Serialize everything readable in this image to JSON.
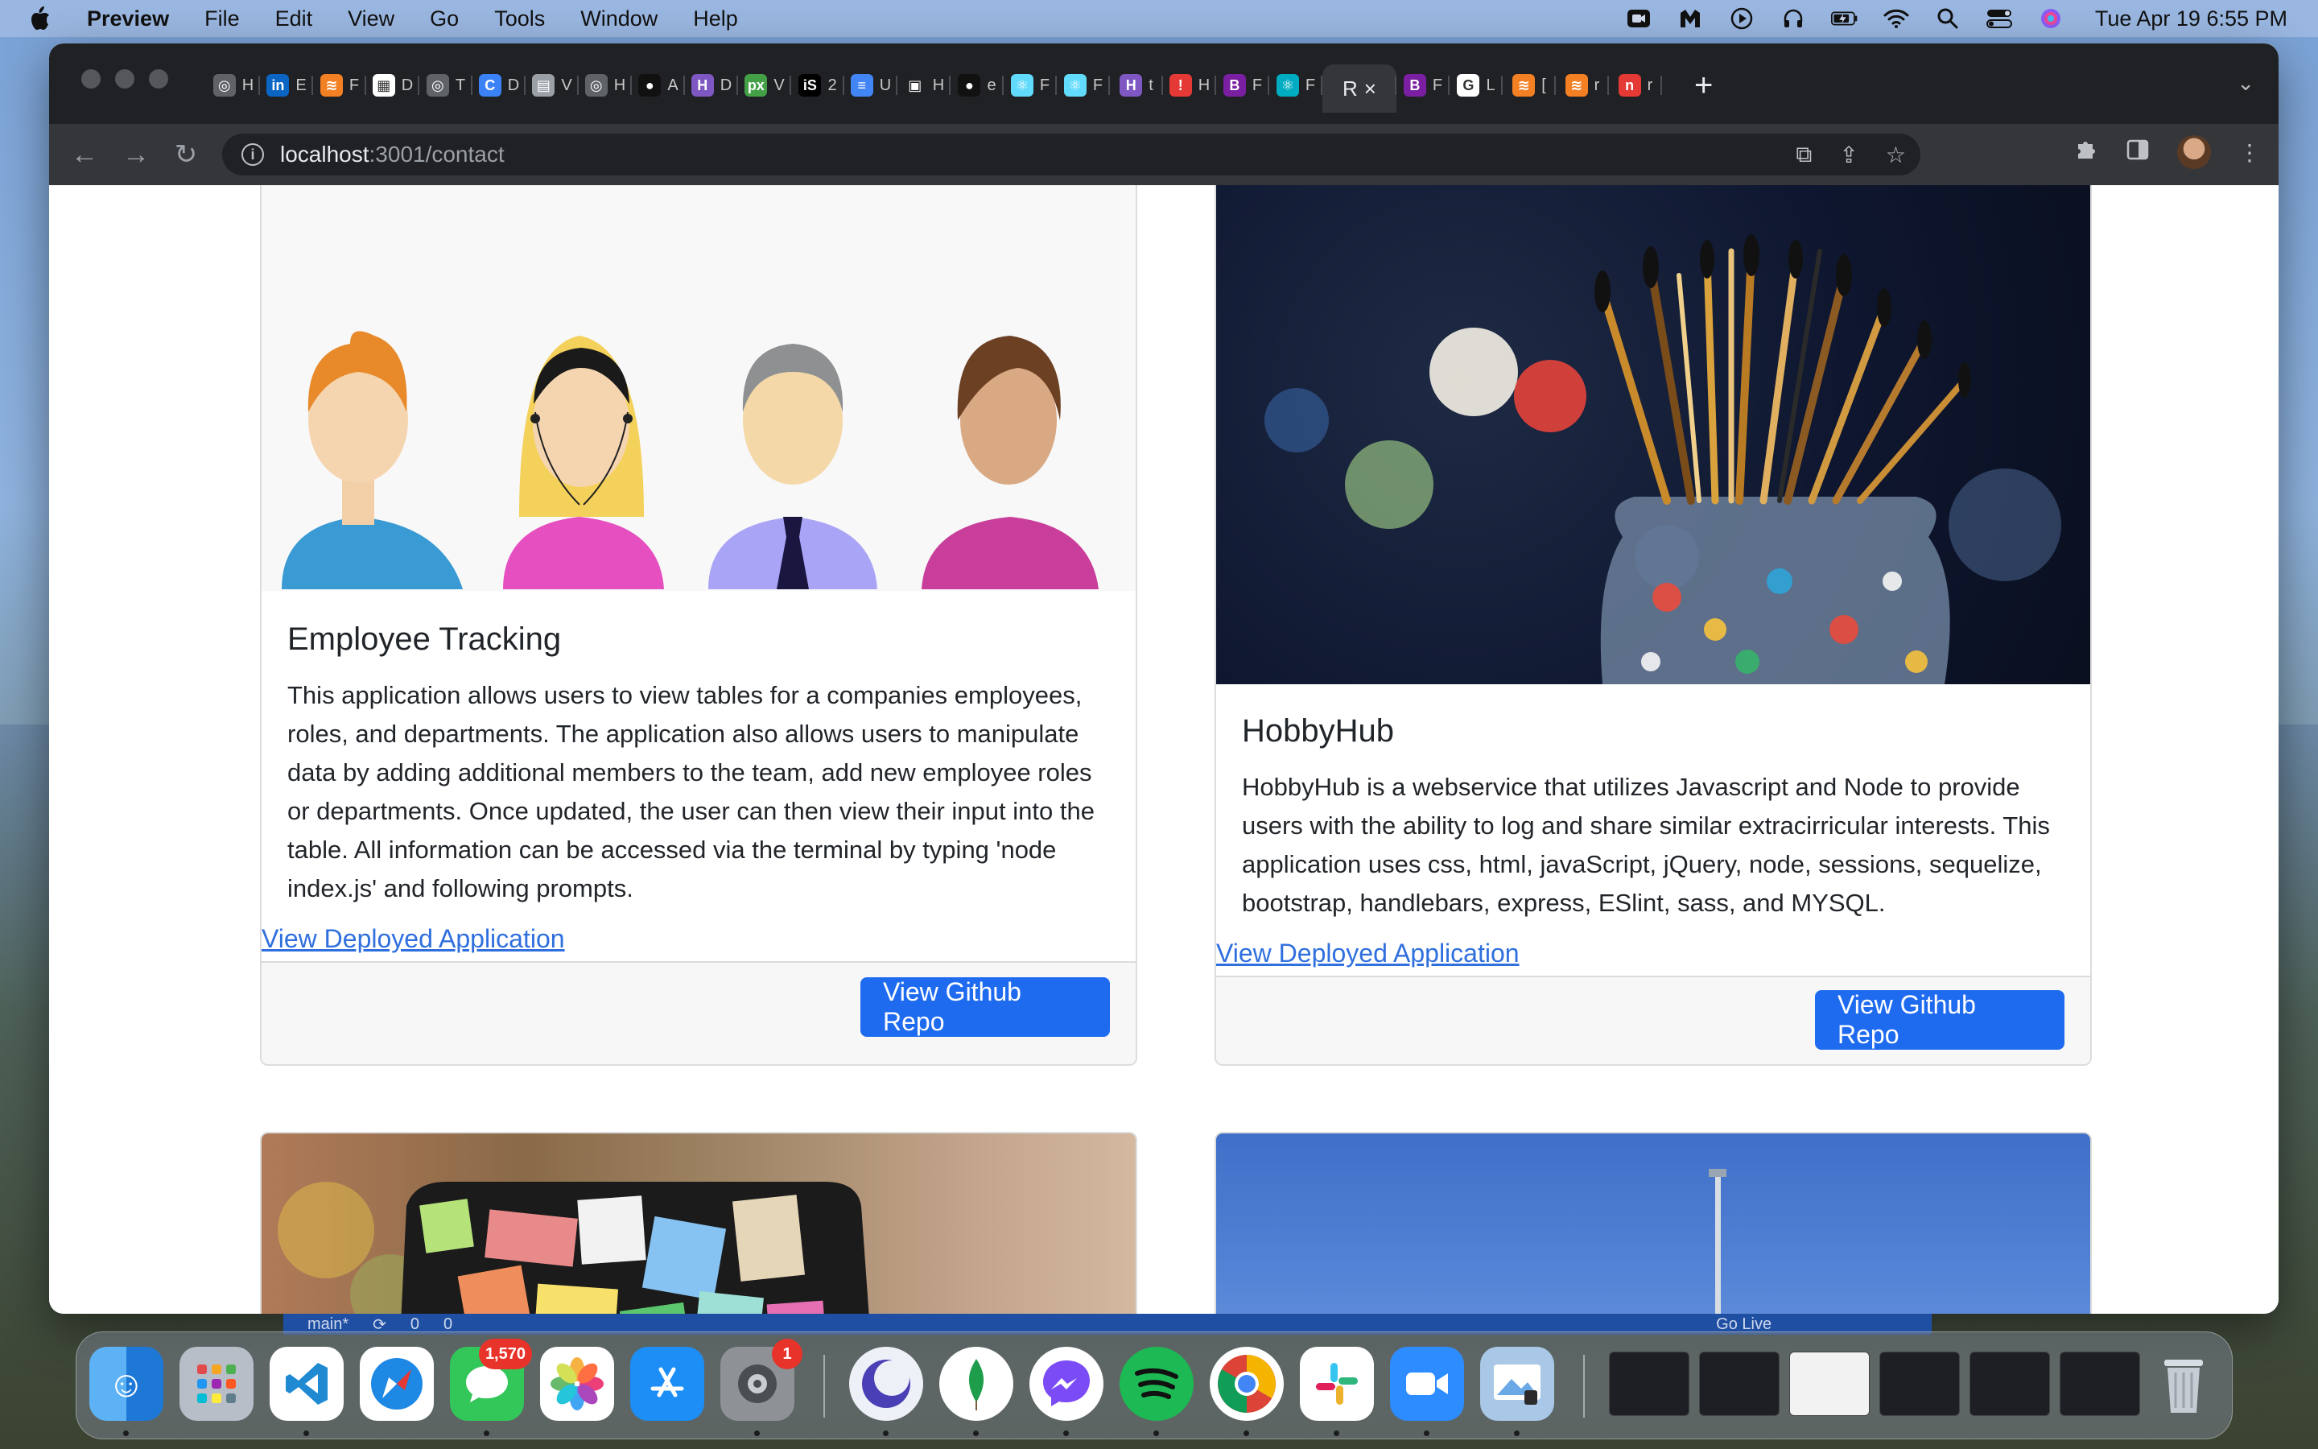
{
  "menubar": {
    "app_name": "Preview",
    "items": [
      "File",
      "Edit",
      "View",
      "Go",
      "Tools",
      "Window",
      "Help"
    ],
    "clock": "Tue Apr 19  6:55 PM"
  },
  "browser": {
    "active_tab_letter": "R",
    "url_host": "localhost",
    "url_path": ":3001/contact",
    "tabs": [
      {
        "letter": "H",
        "color": "#5f6368",
        "glyph": "◎"
      },
      {
        "letter": "E",
        "color": "#0a66c2",
        "glyph": "in"
      },
      {
        "letter": "F",
        "color": "#f48024",
        "glyph": "≋"
      },
      {
        "letter": "D",
        "color": "#ffffff",
        "glyph": "▦"
      },
      {
        "letter": "T",
        "color": "#5f6368",
        "glyph": "◎"
      },
      {
        "letter": "D",
        "color": "#3b82f6",
        "glyph": "C"
      },
      {
        "letter": "V",
        "color": "#9aa0a6",
        "glyph": "▤"
      },
      {
        "letter": "H",
        "color": "#5f6368",
        "glyph": "◎"
      },
      {
        "letter": "A",
        "color": "#111111",
        "glyph": "●"
      },
      {
        "letter": "D",
        "color": "#7e57c2",
        "glyph": "H"
      },
      {
        "letter": "V",
        "color": "#43a047",
        "glyph": "px"
      },
      {
        "letter": "2",
        "color": "#000000",
        "glyph": "iS"
      },
      {
        "letter": "U",
        "color": "#4285f4",
        "glyph": "≡"
      },
      {
        "letter": "H",
        "color": "#202124",
        "glyph": "▣"
      },
      {
        "letter": "e",
        "color": "#111111",
        "glyph": "●"
      },
      {
        "letter": "F",
        "color": "#61dafb",
        "glyph": "⚛"
      },
      {
        "letter": "F",
        "color": "#61dafb",
        "glyph": "⚛"
      },
      {
        "letter": "t",
        "color": "#7e57c2",
        "glyph": "H"
      },
      {
        "letter": "H",
        "color": "#e53935",
        "glyph": "!"
      },
      {
        "letter": "F",
        "color": "#7b1fa2",
        "glyph": "B"
      },
      {
        "letter": "F",
        "color": "#00acc1",
        "glyph": "⚛"
      }
    ],
    "tabs_after": [
      {
        "letter": "F",
        "color": "#7b1fa2",
        "glyph": "B"
      },
      {
        "letter": "L",
        "color": "#ffffff",
        "glyph": "G"
      },
      {
        "letter": "[",
        "color": "#f48024",
        "glyph": "≋"
      },
      {
        "letter": "r",
        "color": "#f48024",
        "glyph": "≋"
      },
      {
        "letter": "r",
        "color": "#e53935",
        "glyph": "n"
      }
    ]
  },
  "cards": [
    {
      "title": "Employee Tracking",
      "text": "This application allows users to view tables for a companies employees, roles, and departments. The application also allows users to manipulate data by adding additional members to the team, add new employee roles or departments. Once updated, the user can then view their input into the table. All information can be accessed via the terminal by typing 'node index.js' and following prompts.",
      "link": "View Deployed Application",
      "button": "View Github Repo"
    },
    {
      "title": "HobbyHub",
      "text": "HobbyHub is a webservice that utilizes Javascript and Node to provide users with the ability to log and share similar extracirricular interests. This application uses css, html, javaScript, jQuery, node, sessions, sequelize, bootstrap, handlebars, express, ESlint, sass, and MYSQL.",
      "link": "View Deployed Application",
      "button": "View Github Repo"
    }
  ],
  "vscode_status": {
    "branch": "main*",
    "errors": "0",
    "warnings": "0",
    "go_live": "Go Live"
  },
  "dock": {
    "messages_badge": "1,570",
    "settings_badge": "1"
  }
}
